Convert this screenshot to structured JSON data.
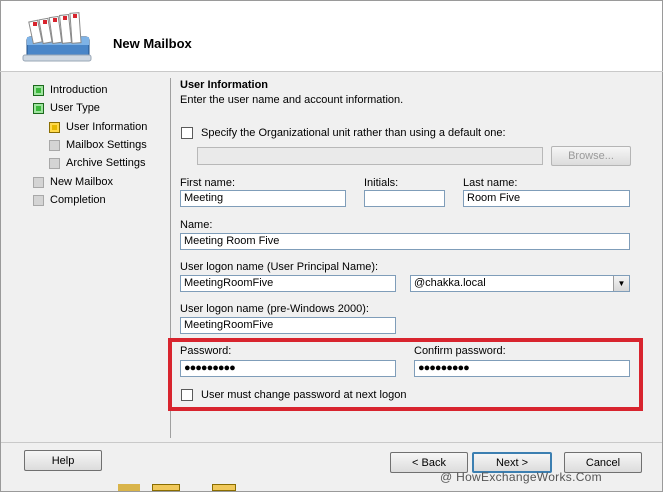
{
  "window": {
    "title": "New Mailbox"
  },
  "nav": {
    "items": [
      {
        "label": "Introduction",
        "state": "complete",
        "level": 0
      },
      {
        "label": "User Type",
        "state": "complete",
        "level": 0
      },
      {
        "label": "User Information",
        "state": "current",
        "level": 1
      },
      {
        "label": "Mailbox Settings",
        "state": "pending",
        "level": 1
      },
      {
        "label": "Archive Settings",
        "state": "pending",
        "level": 1
      },
      {
        "label": "New Mailbox",
        "state": "pending",
        "level": 0
      },
      {
        "label": "Completion",
        "state": "pending",
        "level": 0
      }
    ]
  },
  "section": {
    "title": "User Information",
    "description": "Enter the user name and account information."
  },
  "ou": {
    "checkbox_label": "Specify the Organizational unit rather than using a default one:",
    "checked": false,
    "value": "",
    "browse_label": "Browse..."
  },
  "fields": {
    "first_name": {
      "label": "First name:",
      "value": "Meeting"
    },
    "initials": {
      "label": "Initials:",
      "value": ""
    },
    "last_name": {
      "label": "Last name:",
      "value": "Room Five"
    },
    "name": {
      "label": "Name:",
      "value": "Meeting Room Five"
    },
    "upn": {
      "label": "User logon name (User Principal Name):",
      "value": "MeetingRoomFive",
      "domain": "@chakka.local"
    },
    "pre2000": {
      "label": "User logon name (pre-Windows 2000):",
      "value": "MeetingRoomFive"
    },
    "password": {
      "label": "Password:",
      "value": "●●●●●●●●●"
    },
    "confirm_password": {
      "label": "Confirm password:",
      "value": "●●●●●●●●●"
    },
    "must_change": {
      "label": "User must change password at next logon",
      "checked": false
    }
  },
  "buttons": {
    "help": "Help",
    "back": "< Back",
    "next": "Next >",
    "cancel": "Cancel"
  },
  "watermark": "@ HowExchangeWorks.Com",
  "colors": {
    "highlight_border": "#d8242e",
    "pane_bg": "#f0f0f0",
    "default_button": "#3c7fb1"
  },
  "icons": {
    "header": "mailbox-trays-icon",
    "dropdown": "dropdown-arrow-icon"
  }
}
